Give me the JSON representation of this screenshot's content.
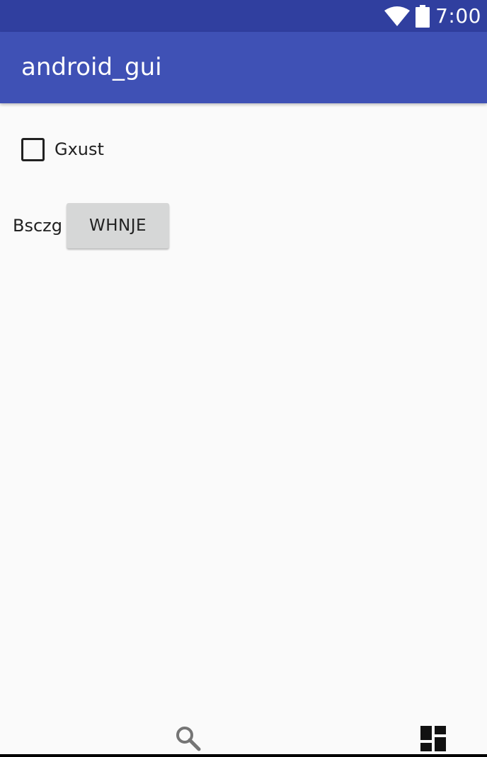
{
  "status_bar": {
    "time": "7:00",
    "icons": [
      "wifi-icon",
      "battery-icon"
    ]
  },
  "app_bar": {
    "title": "android_gui"
  },
  "checkbox": {
    "label": "Gxust",
    "checked": false
  },
  "row": {
    "label": "Bsczg",
    "button_label": "WHNJE"
  },
  "bottom_icons": [
    "search-icon",
    "dashboard-icon"
  ],
  "colors": {
    "status_bar": "#303f9f",
    "app_bar": "#3f51b5",
    "background": "#fafafa",
    "button": "#d6d7d7",
    "text": "#212121",
    "icon_gray": "#757575"
  }
}
